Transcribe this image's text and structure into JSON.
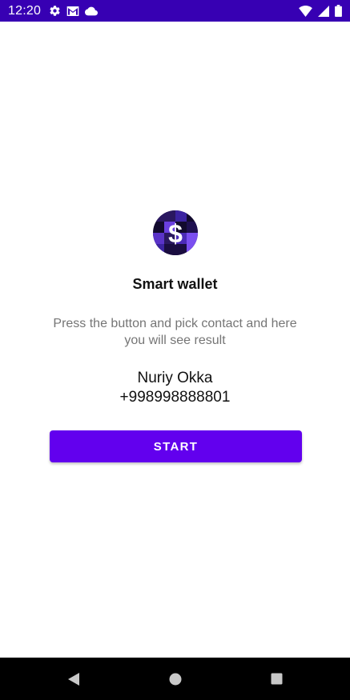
{
  "status_bar": {
    "time": "12:20",
    "left_icons": [
      "settings-icon",
      "gmail-icon",
      "cloud-icon"
    ],
    "right_icons": [
      "wifi-icon",
      "signal-icon",
      "battery-icon"
    ],
    "background": "#3700b3"
  },
  "main": {
    "logo_icon": "dollar-wallet-logo-icon",
    "title": "Smart wallet",
    "description": "Press the button and pick contact and here you will see result",
    "contact_name": "Nuriy Okka",
    "contact_phone": "+998998888801",
    "start_button": "START"
  },
  "colors": {
    "primary": "#6200ee",
    "primary_dark": "#3700b3",
    "description_text": "#757575"
  },
  "nav_bar": {
    "buttons": [
      "back-icon",
      "home-icon",
      "recents-icon"
    ]
  }
}
